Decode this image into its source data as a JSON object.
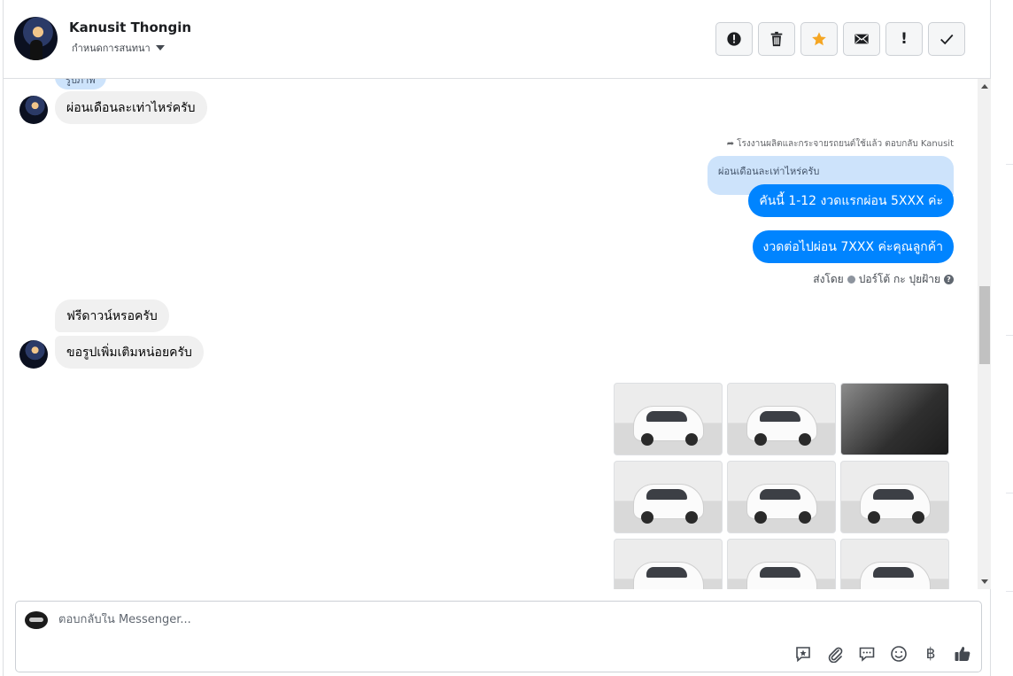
{
  "header": {
    "name": "Kanusit Thongin",
    "subtitle": "กำหนดการสนทนา"
  },
  "actions": [
    {
      "name": "mark-spam-button",
      "icon": "alert-circle-icon"
    },
    {
      "name": "delete-button",
      "icon": "trash-icon"
    },
    {
      "name": "star-button",
      "icon": "star-icon",
      "color": "#f5a623"
    },
    {
      "name": "mark-unread-button",
      "icon": "envelope-icon"
    },
    {
      "name": "follow-up-button",
      "icon": "exclamation-icon",
      "glyph": "!"
    },
    {
      "name": "mark-done-button",
      "icon": "check-icon"
    }
  ],
  "chat": {
    "top_partial_label": "รูปภาพ",
    "incoming_1": "ผ่อนเดือนละเท่าไหร่ครับ",
    "reply_note": "โรงงานผลิตและกระจายรถยนต์ใช้แล้ว ตอบกลับ Kanusit",
    "quoted": "ผ่อนเดือนละเท่าไหร่ครับ",
    "outgoing_1": "คันนี้ 1-12 งวดแรกผ่อน 5XXX ค่ะ",
    "outgoing_2": "งวดต่อไปผ่อน 7XXX  ค่ะคุณลูกค้า",
    "sent_by_prefix": "ส่งโดย",
    "sent_by_name": "ปอร์โต้ กะ ปุยฝ้าย",
    "incoming_2": "ฟรีดาวน์หรอครับ",
    "incoming_3": "ขอรูปเพิ่มเติมหน่อยครับ"
  },
  "photos": [
    {
      "name": "car-photo-front-left"
    },
    {
      "name": "car-photo-front"
    },
    {
      "name": "car-photo-interior",
      "interior": true
    },
    {
      "name": "car-photo-rear-left"
    },
    {
      "name": "car-photo-front-right"
    },
    {
      "name": "car-photo-rear"
    },
    {
      "name": "car-photo-rear-angle"
    },
    {
      "name": "car-photo-side-left"
    },
    {
      "name": "car-photo-side-right"
    }
  ],
  "composer": {
    "placeholder": "ตอบกลับใน Messenger...",
    "tools": [
      "saved-reply-icon",
      "attachment-icon",
      "chat-bubble-icon",
      "emoji-icon",
      "baht-icon",
      "thumbs-up-icon"
    ],
    "baht_glyph": "฿"
  },
  "colors": {
    "accent": "#0084ff",
    "quote_bg": "#cde3fb",
    "incoming_bg": "#f0f0f0"
  }
}
